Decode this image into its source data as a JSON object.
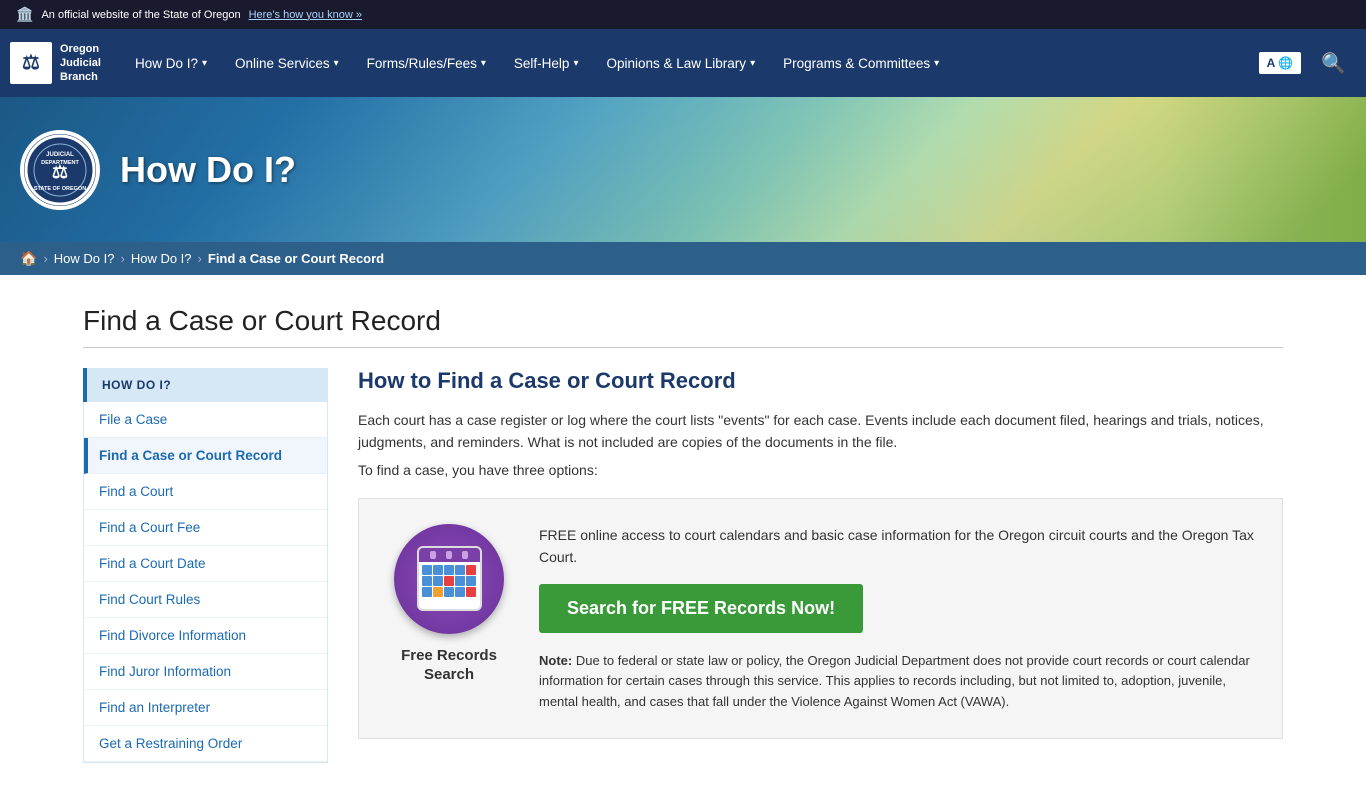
{
  "topBar": {
    "officialText": "An official website of the State of Oregon",
    "linkText": "Here's how you know »",
    "flagEmoji": "🏛️"
  },
  "nav": {
    "logoLine1": "Oregon",
    "logoLine2": "Judicial",
    "logoLine3": "Branch",
    "logoIcon": "⚖",
    "links": [
      {
        "label": "How Do I?",
        "hasDropdown": true
      },
      {
        "label": "Online Services",
        "hasDropdown": true
      },
      {
        "label": "Forms/Rules/Fees",
        "hasDropdown": true
      },
      {
        "label": "Self-Help",
        "hasDropdown": true
      },
      {
        "label": "Opinions & Law Library",
        "hasDropdown": true
      },
      {
        "label": "Programs & Committees",
        "hasDropdown": true
      }
    ],
    "translateLabel": "A🌐",
    "searchIcon": "🔍"
  },
  "hero": {
    "title": "How Do I?",
    "sealText": "JUDICIAL\nDEPARTMENT\nSTATE OF OREGON"
  },
  "breadcrumb": {
    "homeIcon": "🏠",
    "items": [
      {
        "label": "How Do I?",
        "link": true
      },
      {
        "label": "How Do I?",
        "link": true
      },
      {
        "label": "Find a Case or Court Record",
        "current": true
      }
    ]
  },
  "page": {
    "title": "Find a Case or Court Record"
  },
  "sidebar": {
    "heading": "HOW DO I?",
    "items": [
      {
        "label": "File a Case",
        "active": false
      },
      {
        "label": "Find a Case or Court Record",
        "active": true
      },
      {
        "label": "Find a Court",
        "active": false
      },
      {
        "label": "Find a Court Fee",
        "active": false
      },
      {
        "label": "Find a Court Date",
        "active": false
      },
      {
        "label": "Find Court Rules",
        "active": false
      },
      {
        "label": "Find Divorce Information",
        "active": false
      },
      {
        "label": "Find Juror Information",
        "active": false
      },
      {
        "label": "Find an Interpreter",
        "active": false
      },
      {
        "label": "Get a Restraining Order",
        "active": false
      }
    ]
  },
  "main": {
    "sectionTitle": "How to Find a Case or Court Record",
    "introParagraph": "Each court has a case register or log where the court lists \"events\" for each case. Events include each document filed, hearings and trials, notices, judgments, and reminders. What is not included are copies of the documents in the file.",
    "introSub": "To find a case, you have three options:",
    "card": {
      "iconLabel": "Free Records\nSearch",
      "description": "FREE online access to court calendars and basic case information for the Oregon circuit courts and the Oregon Tax Court.",
      "buttonLabel": "Search for FREE Records Now!",
      "noteLabel": "Note:",
      "noteText": "Due to federal or state law or policy, the Oregon Judicial Department does not provide court records or court calendar information for certain cases through this service. This applies to records including, but not limited to, adoption, juvenile, mental health, and cases that fall under the Violence Against Women Act (VAWA)."
    }
  }
}
